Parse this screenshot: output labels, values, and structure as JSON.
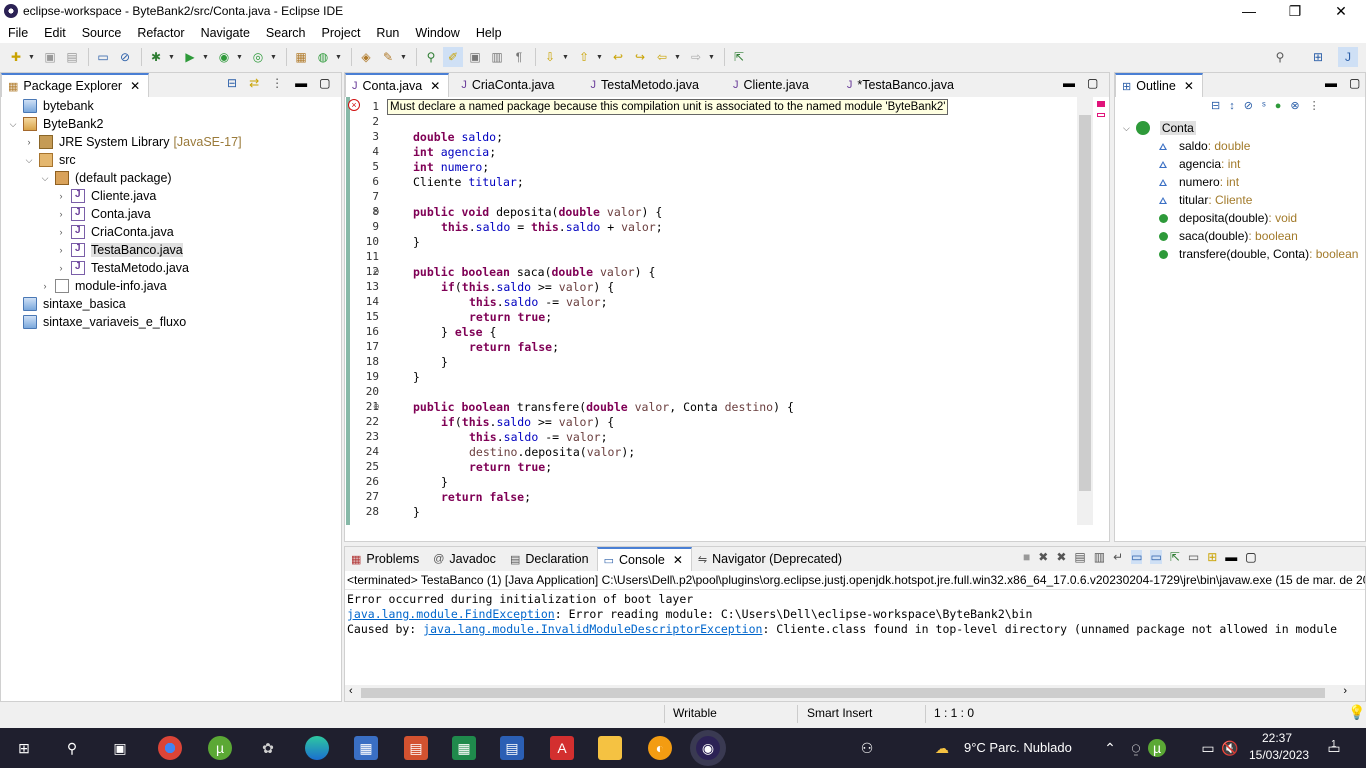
{
  "window": {
    "title": "eclipse-workspace - ByteBank2/src/Conta.java - Eclipse IDE",
    "minimize": "—",
    "maximize": "❐",
    "close": "✕"
  },
  "menu": [
    "File",
    "Edit",
    "Source",
    "Refactor",
    "Navigate",
    "Search",
    "Project",
    "Run",
    "Window",
    "Help"
  ],
  "package_explorer": {
    "title": "Package Explorer",
    "items": [
      {
        "label": "bytebank",
        "extra": "",
        "icon": "project-icon"
      },
      {
        "label": "ByteBank2",
        "extra": "",
        "icon": "project-icon"
      },
      {
        "label": "JRE System Library",
        "extra": "[JavaSE-17]",
        "icon": "library-icon"
      },
      {
        "label": "src",
        "extra": "",
        "icon": "source-folder-icon"
      },
      {
        "label": "(default package)",
        "extra": "",
        "icon": "package-icon"
      },
      {
        "label": "Cliente.java",
        "extra": "",
        "icon": "java-file-icon"
      },
      {
        "label": "Conta.java",
        "extra": "",
        "icon": "java-file-icon"
      },
      {
        "label": "CriaConta.java",
        "extra": "",
        "icon": "java-file-icon"
      },
      {
        "label": "TestaBanco.java",
        "extra": "",
        "icon": "java-file-icon"
      },
      {
        "label": "TestaMetodo.java",
        "extra": "",
        "icon": "java-file-icon"
      },
      {
        "label": "module-info.java",
        "extra": "",
        "icon": "java-file-icon"
      },
      {
        "label": "sintaxe_basica",
        "extra": "",
        "icon": "project-icon"
      },
      {
        "label": "sintaxe_variaveis_e_fluxo",
        "extra": "",
        "icon": "project-icon"
      }
    ]
  },
  "editor": {
    "tabs": [
      "Conta.java",
      "CriaConta.java",
      "TestaMetodo.java",
      "Cliente.java",
      "*TestaBanco.java"
    ],
    "error_tooltip": "Must declare a named package because this compilation unit is associated to the named module 'ByteBank2'",
    "line_numbers": [
      "1",
      "2",
      "3",
      "4",
      "5",
      "6",
      "7",
      "8",
      "9",
      "10",
      "11",
      "12",
      "13",
      "14",
      "15",
      "16",
      "17",
      "18",
      "19",
      "20",
      "21",
      "22",
      "23",
      "24",
      "25",
      "26",
      "27",
      "28"
    ],
    "code": {
      "l4": "double saldo;",
      "l5": "int agencia;",
      "l6": "int numero;",
      "l7": "Cliente titular;",
      "l9": "public void deposita(double valor) {",
      "l10": "this.saldo = this.saldo + valor;",
      "l11": "}",
      "l13": "public boolean saca(double valor) {",
      "l14": "if(this.saldo >= valor) {",
      "l15": "this.saldo -= valor;",
      "l16": "return true;",
      "l17": "} else {",
      "l18": "return false;",
      "l19": "}",
      "l20": "}",
      "l22": "public boolean transfere(double valor, Conta destino) {",
      "l23": "if(this.saldo >= valor) {",
      "l24": "this.saldo -= valor;",
      "l25": "destino.deposita(valor);",
      "l26": "return true;",
      "l27": "}",
      "l28": "return false;",
      "l29": "}"
    }
  },
  "outline": {
    "title": "Outline",
    "class_name": "Conta",
    "members": [
      {
        "name": "saldo",
        "type": " : double",
        "kind": "field"
      },
      {
        "name": "agencia",
        "type": " : int",
        "kind": "field"
      },
      {
        "name": "numero",
        "type": " : int",
        "kind": "field"
      },
      {
        "name": "titular",
        "type": " : Cliente",
        "kind": "field"
      },
      {
        "name": "deposita(double)",
        "type": " : void",
        "kind": "method"
      },
      {
        "name": "saca(double)",
        "type": " : boolean",
        "kind": "method"
      },
      {
        "name": "transfere(double, Conta)",
        "type": " : boolean",
        "kind": "method"
      }
    ]
  },
  "bottom_panel": {
    "tabs": [
      "Problems",
      "Javadoc",
      "Declaration",
      "Console",
      "Navigator (Deprecated)"
    ],
    "terminated": "<terminated> TestaBanco (1) [Java Application] C:\\Users\\Dell\\.p2\\pool\\plugins\\org.eclipse.justj.openjdk.hotspot.jre.full.win32.x86_64_17.0.6.v20230204-1729\\jre\\bin\\javaw.exe  (15 de mar. de 202",
    "line1": "Error occurred during initialization of boot layer",
    "line2_link": "java.lang.module.FindException",
    "line2_rest": ": Error reading module: C:\\Users\\Dell\\eclipse-workspace\\ByteBank2\\bin",
    "line3_prefix": "Caused by: ",
    "line3_link": "java.lang.module.InvalidModuleDescriptorException",
    "line3_rest": ": Cliente.class found in top-level directory (unnamed package not allowed in module"
  },
  "status": {
    "writable": "Writable",
    "insert_mode": "Smart Insert",
    "position": "1 : 1 : 0"
  },
  "taskbar": {
    "weather": "9°C  Parc. Nublado",
    "time": "22:37",
    "date": "15/03/2023",
    "notifications": "1"
  },
  "colors": {
    "accent": "#4a7fd4",
    "keyword": "#7f0055",
    "field": "#0000c0",
    "error": "#d01010",
    "taskbar": "#1f1f2e"
  }
}
